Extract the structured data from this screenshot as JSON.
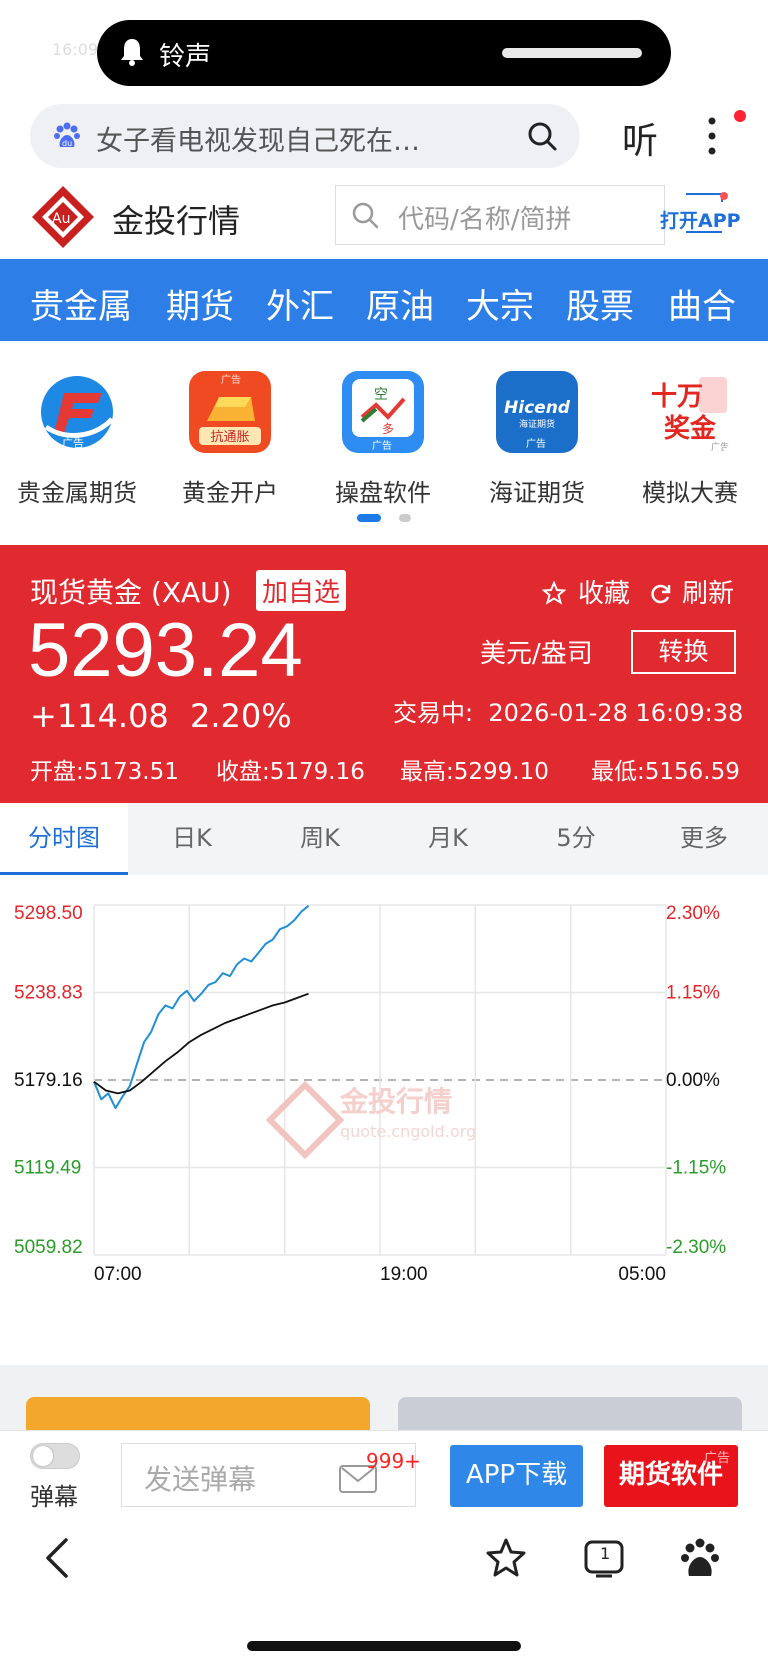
{
  "status": {
    "time": "16:09",
    "notification": "铃声"
  },
  "browser": {
    "search_query": "女子看电视发现自己死在…",
    "listen_label": "听"
  },
  "site": {
    "title": "金投行情",
    "search_placeholder": "代码/名称/简拼",
    "open_app": "打开APP"
  },
  "categories": [
    "贵金属",
    "期货",
    "外汇",
    "原油",
    "大宗",
    "股票",
    "曲合"
  ],
  "apps": [
    {
      "name": "贵金属期货",
      "icon": "precious-metal-futures-icon"
    },
    {
      "name": "黄金开户",
      "icon": "gold-account-icon",
      "sub": "抗通胀"
    },
    {
      "name": "操盘软件",
      "icon": "trading-software-icon"
    },
    {
      "name": "海证期货",
      "icon": "hicend-futures-icon",
      "brand": "Hicend",
      "brand_sub": "海证期货"
    },
    {
      "name": "模拟大赛",
      "icon": "simulation-contest-icon",
      "prize_top": "十万",
      "prize_bottom": "奖金"
    }
  ],
  "ad_label": "广告",
  "quote": {
    "name": "现货黄金 (XAU)",
    "add_watch": "加自选",
    "favorite": "收藏",
    "refresh": "刷新",
    "price": "5293.24",
    "unit": "美元/盎司",
    "convert": "转换",
    "change": "+114.08",
    "change_pct": "2.20%",
    "trade_status": "交易中:",
    "trade_time": "2026-01-28 16:09:38",
    "open": "开盘:5173.51",
    "close": "收盘:5179.16",
    "high": "最高:5299.10",
    "low": "最低:5156.59"
  },
  "chart_tabs": [
    "分时图",
    "日K",
    "周K",
    "月K",
    "5分",
    "更多"
  ],
  "chart_data": {
    "type": "line",
    "y_left_ticks": [
      "5298.50",
      "5238.83",
      "5179.16",
      "5119.49",
      "5059.82"
    ],
    "y_right_ticks": [
      "2.30%",
      "1.15%",
      "0.00%",
      "-1.15%",
      "-2.30%"
    ],
    "x_ticks": [
      "07:00",
      "19:00",
      "05:00"
    ],
    "ylim": [
      5059.82,
      5298.5
    ],
    "baseline": 5179.16,
    "watermark": "金投行情",
    "watermark_sub": "quote.cngold.org",
    "series": [
      {
        "color": "#1f8fd6",
        "x": [
          0.0,
          0.3,
          0.6,
          0.9,
          1.2,
          1.5,
          1.8,
          2.1,
          2.4,
          2.7,
          3.0,
          3.3,
          3.6,
          3.9,
          4.2,
          4.5,
          4.8,
          5.1,
          5.4,
          5.7,
          6.0,
          6.3,
          6.6,
          6.9,
          7.2,
          7.5,
          7.8,
          8.1,
          8.4,
          8.7,
          9.0
        ],
        "values": [
          5178,
          5166,
          5170,
          5160,
          5168,
          5175,
          5190,
          5205,
          5212,
          5224,
          5230,
          5228,
          5236,
          5240,
          5233,
          5238,
          5244,
          5246,
          5252,
          5250,
          5258,
          5262,
          5260,
          5266,
          5272,
          5275,
          5282,
          5284,
          5288,
          5294,
          5298
        ]
      },
      {
        "color": "#111111",
        "x": [
          0.0,
          0.5,
          1.0,
          1.5,
          2.0,
          2.5,
          3.0,
          3.5,
          4.0,
          4.5,
          5.0,
          5.5,
          6.0,
          6.5,
          7.0,
          7.5,
          8.0,
          8.5,
          9.0
        ],
        "values": [
          5178,
          5172,
          5170,
          5172,
          5178,
          5185,
          5192,
          5198,
          5205,
          5210,
          5214,
          5218,
          5221,
          5224,
          5227,
          5230,
          5232,
          5235,
          5238
        ]
      }
    ]
  },
  "action_bar": {
    "barrage": "弹幕",
    "send_placeholder": "发送弹幕",
    "badge": "999+",
    "download": "APP下载",
    "futures_software": "期货软件"
  },
  "bottom_nav": {
    "tab_count": "1"
  }
}
